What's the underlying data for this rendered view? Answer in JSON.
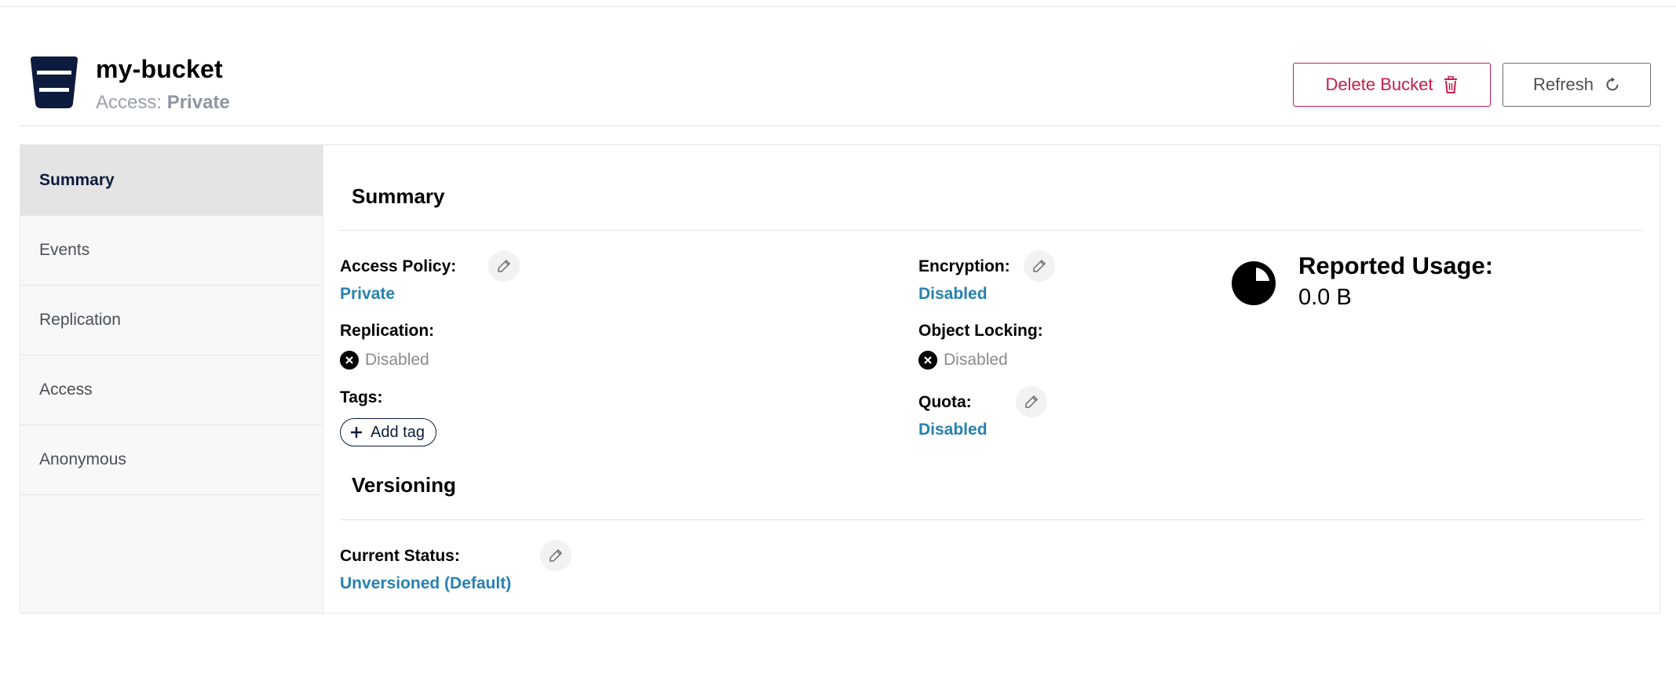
{
  "header": {
    "bucket_name": "my-bucket",
    "access_label": "Access:",
    "access_value": "Private",
    "delete_label": "Delete Bucket",
    "refresh_label": "Refresh",
    "icons": {
      "bucket": "bucket-icon",
      "delete": "trash-icon",
      "refresh": "refresh-icon"
    },
    "colors": {
      "brand": "#0d1b3e",
      "danger": "#c51d4a"
    }
  },
  "sidebar": {
    "items": [
      {
        "label": "Summary",
        "active": true
      },
      {
        "label": "Events",
        "active": false
      },
      {
        "label": "Replication",
        "active": false
      },
      {
        "label": "Access",
        "active": false
      },
      {
        "label": "Anonymous",
        "active": false
      }
    ]
  },
  "summary": {
    "title": "Summary",
    "access_policy": {
      "label": "Access Policy:",
      "value": "Private"
    },
    "replication": {
      "label": "Replication:",
      "value": "Disabled"
    },
    "tags": {
      "label": "Tags:",
      "add_label": "Add tag"
    },
    "encryption": {
      "label": "Encryption:",
      "value": "Disabled"
    },
    "object_locking": {
      "label": "Object Locking:",
      "value": "Disabled"
    },
    "quota": {
      "label": "Quota:",
      "value": "Disabled"
    },
    "usage": {
      "label": "Reported Usage:",
      "value": "0.0 B"
    },
    "link_color": "#2781b0"
  },
  "versioning": {
    "title": "Versioning",
    "status_label": "Current Status:",
    "status_value": "Unversioned (Default)"
  }
}
